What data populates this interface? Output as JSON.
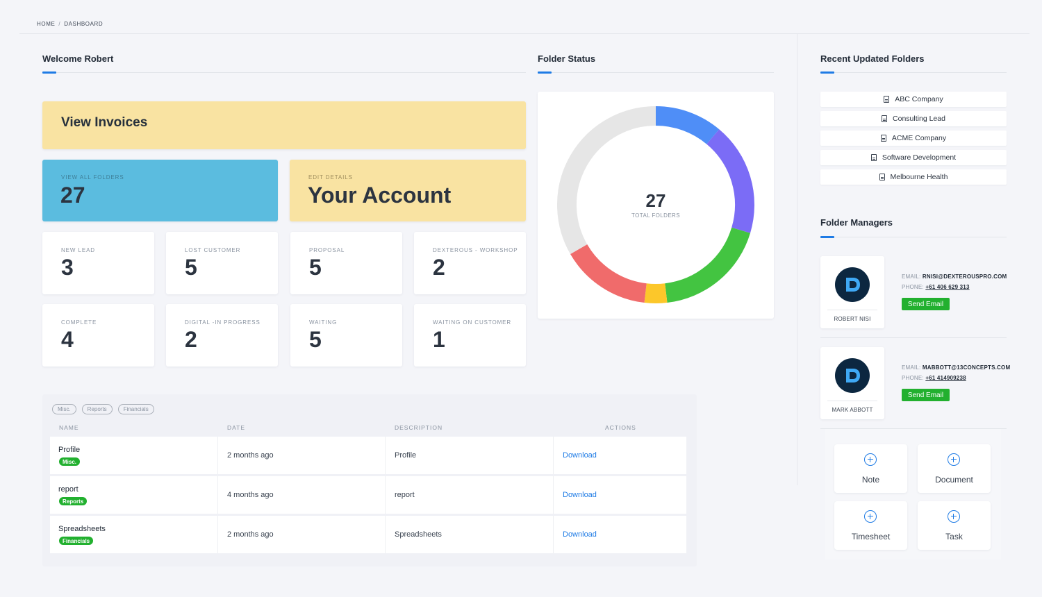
{
  "breadcrumb": {
    "home": "HOME",
    "separator": "/",
    "current": "DASHBOARD"
  },
  "welcome": {
    "title": "Welcome Robert"
  },
  "cards": {
    "invoices": {
      "label": "View Invoices"
    },
    "folders": {
      "small_label": "VIEW ALL FOLDERS",
      "value": "27"
    },
    "account": {
      "small_label": "EDIT DETAILS",
      "value": "Your Account"
    }
  },
  "stats": [
    {
      "label": "NEW LEAD",
      "value": "3"
    },
    {
      "label": "LOST CUSTOMER",
      "value": "5"
    },
    {
      "label": "PROPOSAL",
      "value": "5"
    },
    {
      "label": "DEXTEROUS - WORKSHOP",
      "value": "2"
    },
    {
      "label": "COMPLETE",
      "value": "4"
    },
    {
      "label": "DIGITAL -IN PROGRESS",
      "value": "2"
    },
    {
      "label": "WAITING",
      "value": "5"
    },
    {
      "label": "WAITING ON CUSTOMER",
      "value": "1"
    }
  ],
  "folder_status": {
    "title": "Folder Status",
    "center_value": "27",
    "center_label": "TOTAL FOLDERS",
    "segments": [
      {
        "value": 3,
        "color": "#4f8ef7"
      },
      {
        "value": 5,
        "color": "#7b6cf6"
      },
      {
        "value": 5,
        "color": "#43c441"
      },
      {
        "value": 1,
        "color": "#fcc72a"
      },
      {
        "value": 4,
        "color": "#f06b6b"
      },
      {
        "value": 9,
        "color": "#e6e6e6"
      }
    ]
  },
  "recent": {
    "title": "Recent Updated Folders",
    "items": [
      "ABC Company",
      "Consulting Lead",
      "ACME Company",
      "Software Development",
      "Melbourne Health"
    ]
  },
  "managers": {
    "title": "Folder Managers",
    "email_label": "EMAIL:",
    "phone_label": "PHONE:",
    "send_label": "Send Email",
    "people": [
      {
        "name": "ROBERT NISI",
        "email": "RNISI@DEXTEROUSPRO.COM",
        "phone": "+61 406 629 313"
      },
      {
        "name": "MARK ABBOTT",
        "email": "MABBOTT@13CONCEPTS.COM",
        "phone": "+61 414909238"
      }
    ]
  },
  "quick_actions": [
    "Note",
    "Document",
    "Timesheet",
    "Task"
  ],
  "files": {
    "filters": [
      "Misc.",
      "Reports",
      "Financials"
    ],
    "headers": [
      "NAME",
      "DATE",
      "DESCRIPTION",
      "ACTIONS"
    ],
    "action_label": "Download",
    "rows": [
      {
        "name": "Profile",
        "tag": "Misc.",
        "date": "2 months ago",
        "description": "Profile"
      },
      {
        "name": "report",
        "tag": "Reports",
        "date": "4 months ago",
        "description": "report"
      },
      {
        "name": "Spreadsheets",
        "tag": "Financials",
        "date": "2 months ago",
        "description": "Spreadsheets"
      }
    ]
  },
  "colors": {
    "accent": "#1e7be5",
    "success": "#22b02f",
    "yellow_card": "#f9e3a2",
    "blue_card": "#5bbcdf"
  }
}
